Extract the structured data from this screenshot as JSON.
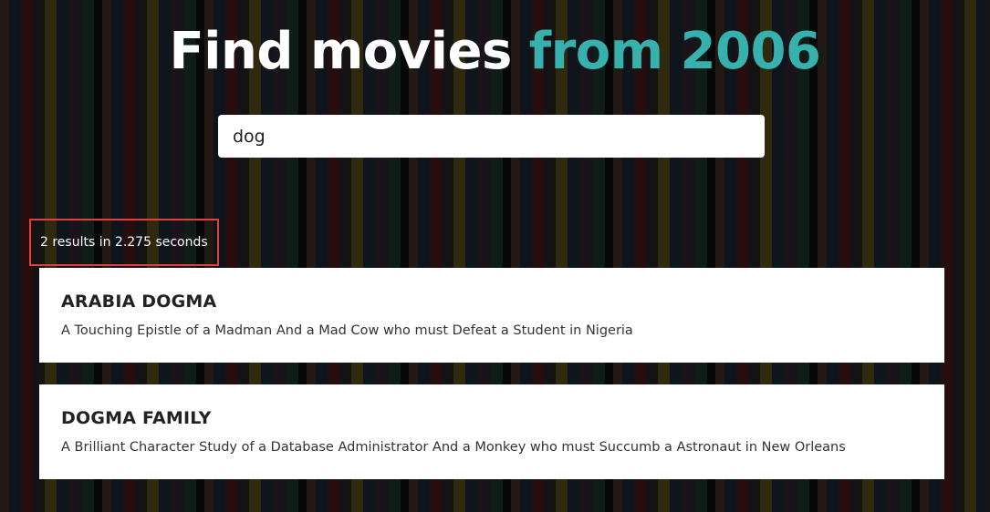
{
  "header": {
    "title_prefix": "Find movies",
    "title_accent": "from 2006"
  },
  "search": {
    "value": "dog"
  },
  "results": {
    "count_text": "2 results in 2.275 seconds",
    "items": [
      {
        "title": "ARABIA DOGMA",
        "description": "A Touching Epistle of a Madman And a Mad Cow who must Defeat a Student in Nigeria"
      },
      {
        "title": "DOGMA FAMILY",
        "description": "A Brilliant Character Study of a Database Administrator And a Monkey who must Succumb a Astronaut in New Orleans"
      }
    ]
  },
  "colors": {
    "accent": "#36b1ad",
    "highlight_border": "#e0413a",
    "card_background": "#ffffff"
  }
}
